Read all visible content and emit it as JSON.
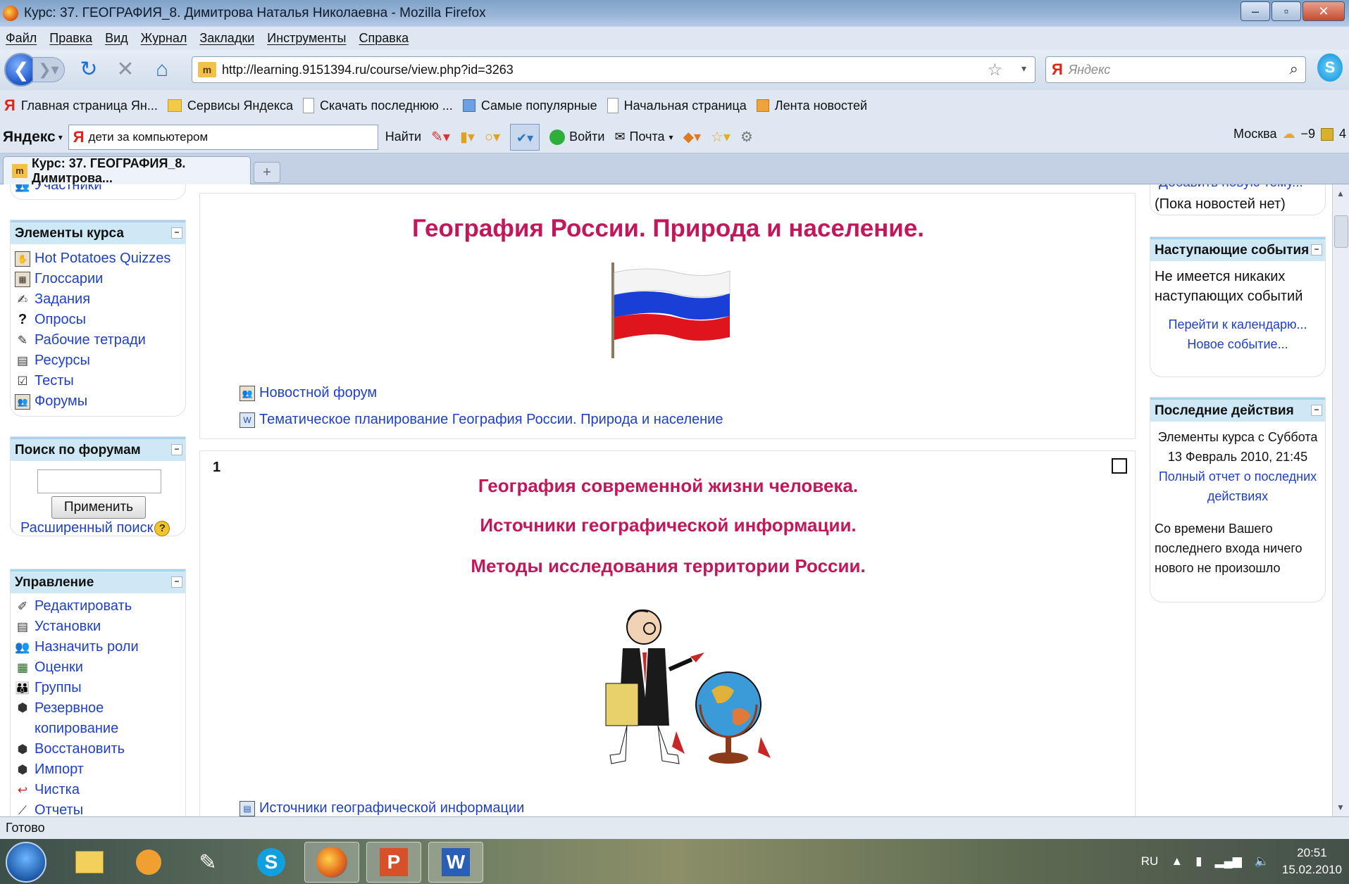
{
  "window": {
    "title": "Курс: 37. ГЕОГРАФИЯ_8. Димитрова Наталья Николаевна - Mozilla Firefox"
  },
  "menu": [
    "Файл",
    "Правка",
    "Вид",
    "Журнал",
    "Закладки",
    "Инструменты",
    "Справка"
  ],
  "nav": {
    "url": "http://learning.9151394.ru/course/view.php?id=3263",
    "search_placeholder": "Яндекс"
  },
  "bookmarks": [
    {
      "label": "Главная страница Ян...",
      "icon": "yandex-icon"
    },
    {
      "label": "Сервисы Яндекса",
      "icon": "folder-icon"
    },
    {
      "label": "Скачать последнюю ...",
      "icon": "page-icon"
    },
    {
      "label": "Самые популярные",
      "icon": "popular-icon"
    },
    {
      "label": "Начальная страница",
      "icon": "page-icon"
    },
    {
      "label": "Лента новостей",
      "icon": "rss-icon"
    }
  ],
  "yandex_bar": {
    "brand": "Яндекс",
    "query": "дети за компьютером",
    "find": "Найти",
    "login": "Войти",
    "mail": "Почта",
    "city": "Москва",
    "temp": "−9",
    "extra": "4"
  },
  "tabs": [
    {
      "label": "Курс: 37. ГЕОГРАФИЯ_8. Димитрова..."
    }
  ],
  "left": {
    "partial_top": "Участники",
    "course_elements": {
      "header": "Элементы курса",
      "items": [
        {
          "label": "Hot Potatoes Quizzes",
          "icon": "hot-potatoes-icon"
        },
        {
          "label": "Глоссарии",
          "icon": "glossary-icon"
        },
        {
          "label": "Задания",
          "icon": "assignment-icon"
        },
        {
          "label": "Опросы",
          "icon": "question-icon"
        },
        {
          "label": "Рабочие тетради",
          "icon": "workbook-icon"
        },
        {
          "label": "Ресурсы",
          "icon": "resource-icon"
        },
        {
          "label": "Тесты",
          "icon": "quiz-icon"
        },
        {
          "label": "Форумы",
          "icon": "forum-icon"
        }
      ]
    },
    "forum_search": {
      "header": "Поиск по форумам",
      "button": "Применить",
      "advanced": "Расширенный поиск"
    },
    "management": {
      "header": "Управление",
      "items": [
        {
          "label": "Редактировать",
          "icon": "edit-icon"
        },
        {
          "label": "Установки",
          "icon": "settings-icon"
        },
        {
          "label": "Назначить роли",
          "icon": "roles-icon"
        },
        {
          "label": "Оценки",
          "icon": "grades-icon"
        },
        {
          "label": "Группы",
          "icon": "groups-icon"
        },
        {
          "label": "Резервное копирование",
          "icon": "backup-icon"
        },
        {
          "label": "Восстановить",
          "icon": "restore-icon"
        },
        {
          "label": "Импорт",
          "icon": "import-icon"
        },
        {
          "label": "Чистка",
          "icon": "reset-icon"
        },
        {
          "label": "Отчеты",
          "icon": "reports-icon"
        }
      ]
    }
  },
  "main": {
    "section0": {
      "title": "География России. Природа и население.",
      "links": [
        {
          "label": "Новостной форум",
          "icon": "forum-icon"
        },
        {
          "label": "Тематическое планирование География России. Природа и население",
          "icon": "document-icon"
        }
      ]
    },
    "section1": {
      "number": "1",
      "lines": [
        "География современной жизни человека.",
        "Источники географической информации.",
        "Методы исследования территории России."
      ],
      "links": [
        {
          "label": "Источники географической информации",
          "icon": "document-icon"
        }
      ]
    }
  },
  "right": {
    "news": {
      "partial_top": "Добавить новую тему...",
      "empty": "(Пока новостей нет)"
    },
    "events": {
      "header": "Наступающие события",
      "text": "Не имеется никаких наступающих событий",
      "calendar_link": "Перейти к календарю...",
      "new_event_link": "Новое событие..."
    },
    "activity": {
      "header": "Последние действия",
      "since": "Элементы курса с Суббота 13 Февраль 2010, 21:45",
      "full_report": "Полный отчет о последних действиях",
      "nothing_new": "Со времени Вашего последнего входа ничего нового не произошло"
    }
  },
  "status": "Готово",
  "taskbar": {
    "lang": "RU",
    "time": "20:51",
    "date": "15.02.2010"
  },
  "colors": {
    "section_title": "#c2185b",
    "link": "#1e3fc8",
    "block_header": "#cfe8f5"
  }
}
